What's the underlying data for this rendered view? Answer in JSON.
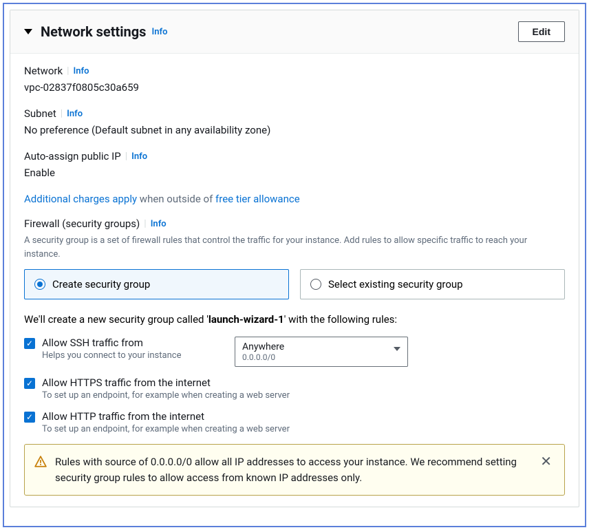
{
  "header": {
    "title": "Network settings",
    "info": "Info",
    "edit": "Edit"
  },
  "network": {
    "label": "Network",
    "info": "Info",
    "value": "vpc-02837f0805c30a659"
  },
  "subnet": {
    "label": "Subnet",
    "info": "Info",
    "value": "No preference (Default subnet in any availability zone)"
  },
  "autoip": {
    "label": "Auto-assign public IP",
    "info": "Info",
    "value": "Enable"
  },
  "charges": {
    "link1": "Additional charges apply",
    "mid": " when outside of ",
    "link2": "free tier allowance"
  },
  "firewall": {
    "label": "Firewall (security groups)",
    "info": "Info",
    "desc": "A security group is a set of firewall rules that control the traffic for your instance. Add rules to allow specific traffic to reach your instance.",
    "option_create": "Create security group",
    "option_existing": "Select existing security group"
  },
  "sgnote": {
    "pre": "We'll create a new security group called '",
    "name": "launch-wizard-1",
    "post": "' with the following rules:"
  },
  "ssh": {
    "label": "Allow SSH traffic from",
    "sub": "Helps you connect to your instance",
    "select_label": "Anywhere",
    "select_sub": "0.0.0.0/0"
  },
  "https": {
    "label": "Allow HTTPS traffic from the internet",
    "sub": "To set up an endpoint, for example when creating a web server"
  },
  "http": {
    "label": "Allow HTTP traffic from the internet",
    "sub": "To set up an endpoint, for example when creating a web server"
  },
  "warning": {
    "text": "Rules with source of 0.0.0.0/0 allow all IP addresses to access your instance. We recommend setting security group rules to allow access from known IP addresses only."
  }
}
